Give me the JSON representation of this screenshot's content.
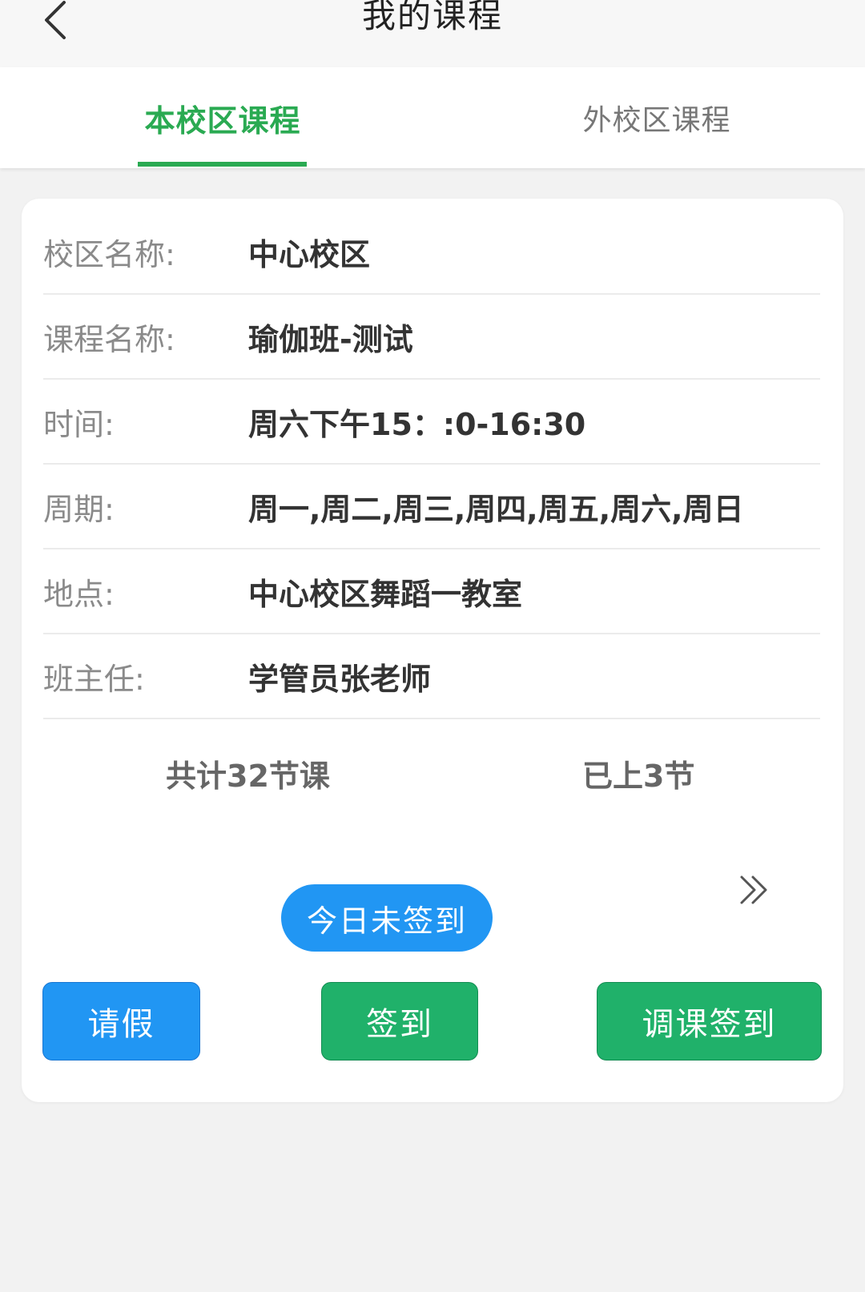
{
  "header": {
    "title": "我的课程",
    "back_icon": "chevron-left-icon"
  },
  "tabs": [
    {
      "label": "本校区课程",
      "active": true
    },
    {
      "label": "外校区课程",
      "active": false
    }
  ],
  "course": {
    "rows": [
      {
        "label": "校区名称:",
        "value": "中心校区"
      },
      {
        "label": "课程名称:",
        "value": "瑜伽班-测试"
      },
      {
        "label": "时间:",
        "value": "周六下午15：:0-16:30"
      },
      {
        "label": "周期:",
        "value": "周一,周二,周三,周四,周五,周六,周日"
      },
      {
        "label": "地点:",
        "value": "中心校区舞蹈一教室"
      },
      {
        "label": "班主任:",
        "value": "学管员张老师"
      }
    ],
    "total_lessons": "共计32节课",
    "attended_lessons": "已上3节",
    "status": "今日未签到",
    "more_icon": "double-chevron-right-icon"
  },
  "actions": {
    "leave_label": "请假",
    "checkin_label": "签到",
    "adjust_checkin_label": "调课签到"
  },
  "colors": {
    "accent_green": "#2aaa52",
    "button_green": "#20b16a",
    "button_blue": "#2196f3"
  }
}
